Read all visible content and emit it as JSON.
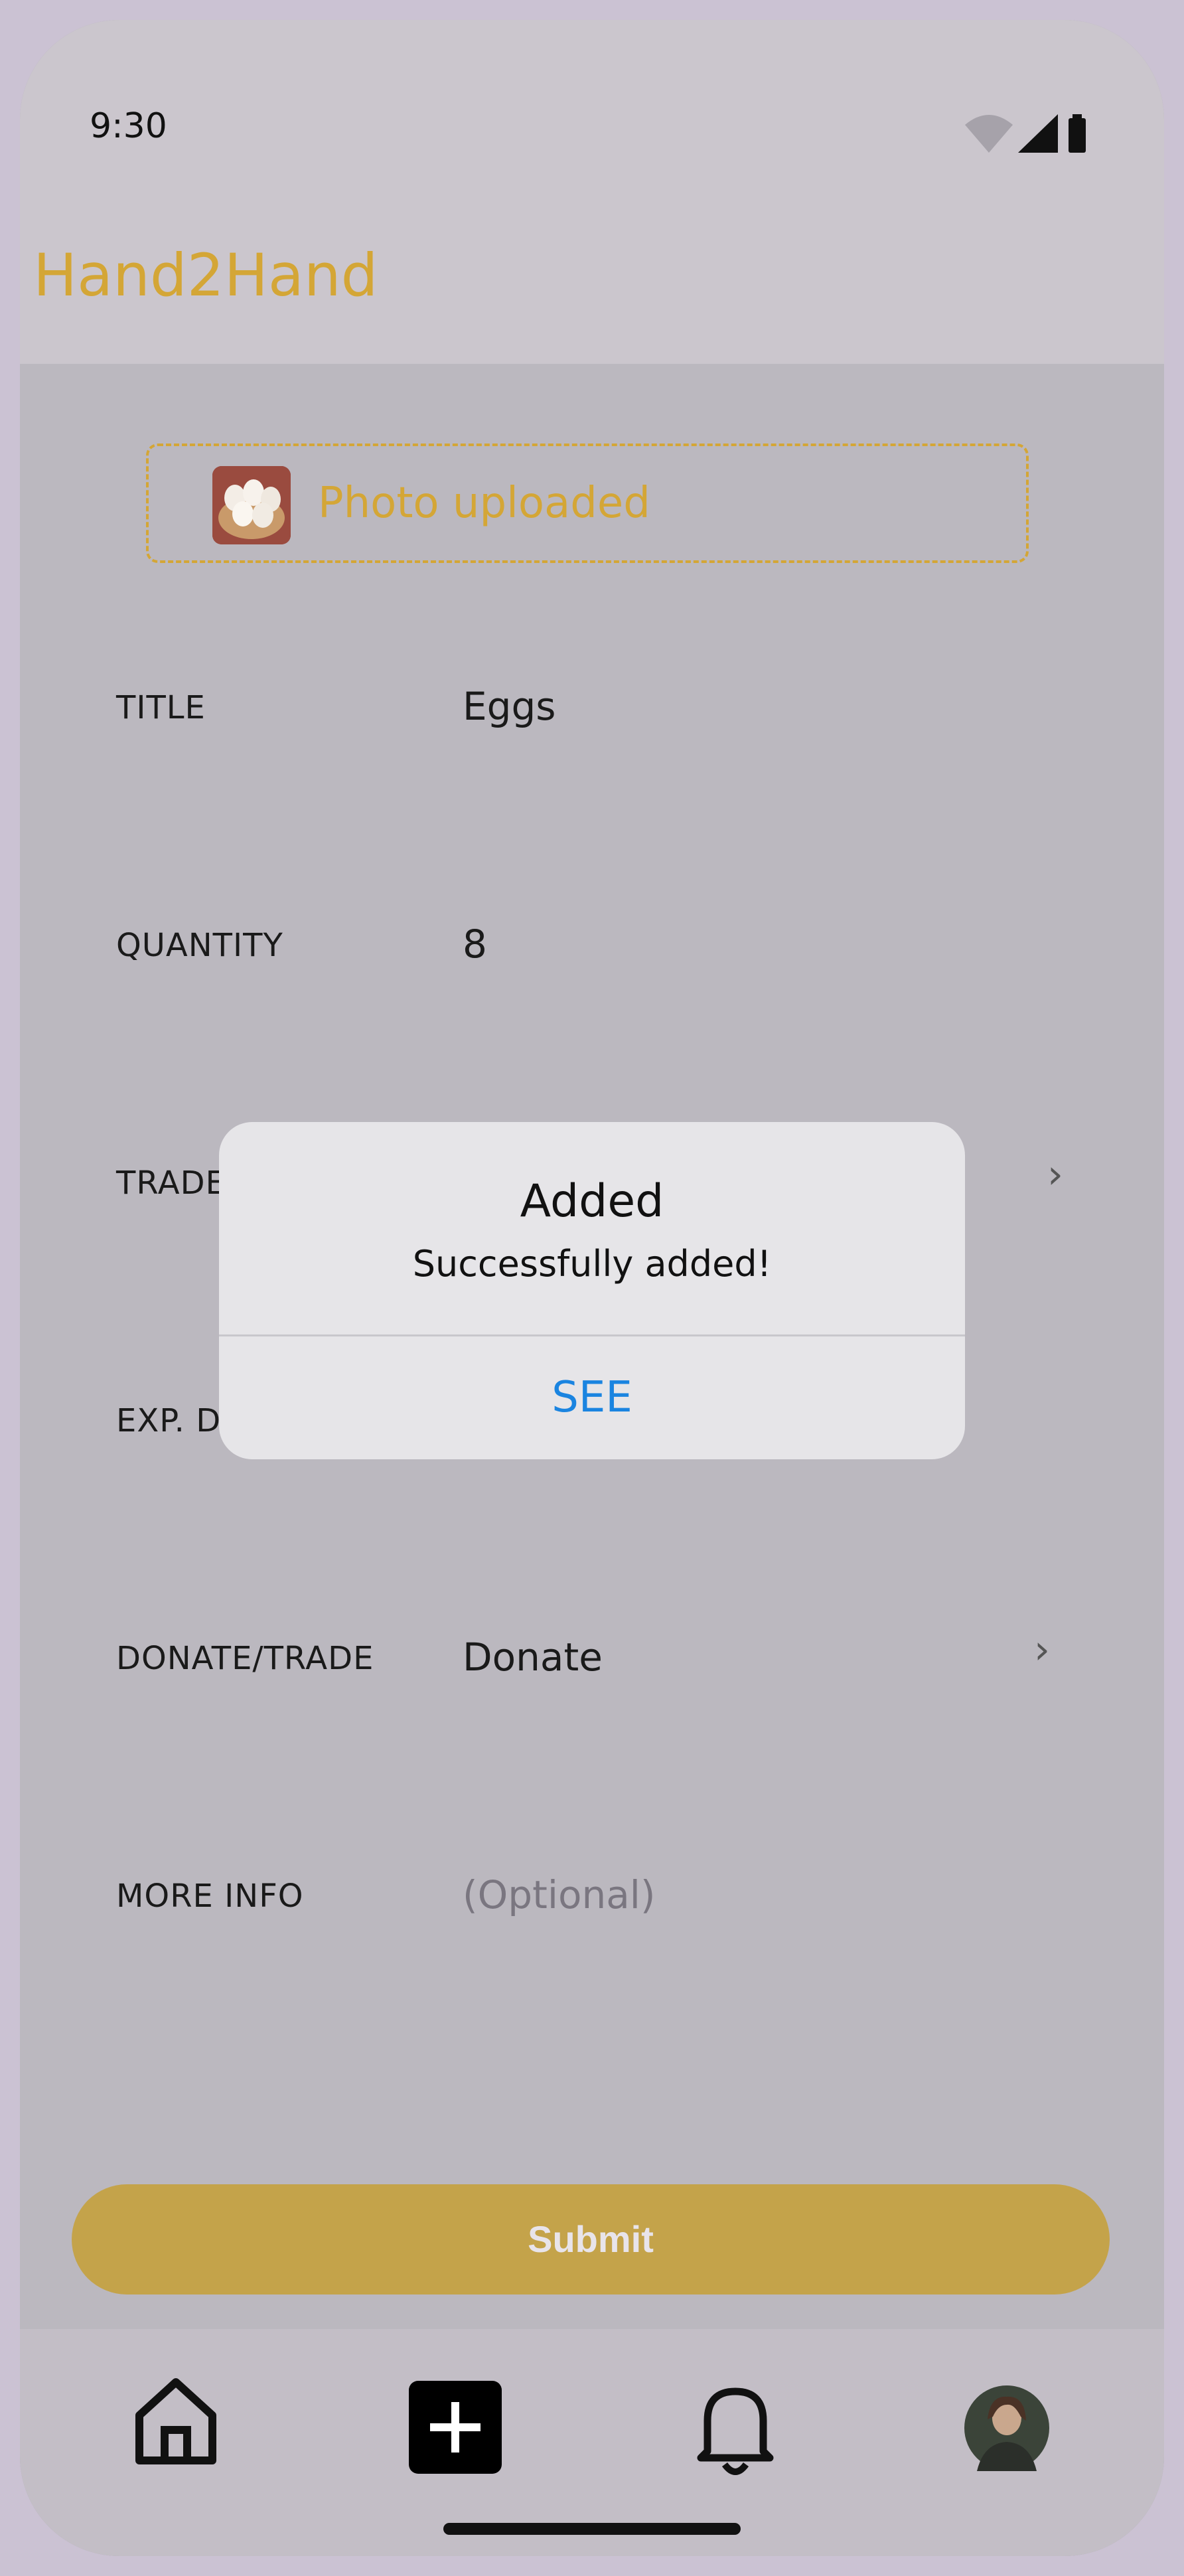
{
  "status_bar": {
    "time": "9:30"
  },
  "app": {
    "title": "Hand2Hand"
  },
  "upload": {
    "label": "Photo uploaded",
    "thumbnail_icon": "eggs-photo"
  },
  "form": {
    "title": {
      "label": "TITLE",
      "value": "Eggs"
    },
    "quantity": {
      "label": "QUANTITY",
      "value": "8"
    },
    "trade": {
      "label": "TRADE"
    },
    "exp_date": {
      "label": "EXP. D"
    },
    "donate_trade": {
      "label": "DONATE/TRADE",
      "value": "Donate"
    },
    "more_info": {
      "label": "MORE INFO",
      "placeholder": "(Optional)"
    }
  },
  "submit": {
    "label": "Submit"
  },
  "dialog": {
    "title": "Added",
    "message": "Successfully added!",
    "action": "SEE"
  },
  "nav": {
    "items": [
      "home-icon",
      "add-icon",
      "bell-icon",
      "avatar"
    ]
  },
  "colors": {
    "accent": "#d4a636",
    "submit": "#c4a34a",
    "link": "#1a84e0"
  }
}
